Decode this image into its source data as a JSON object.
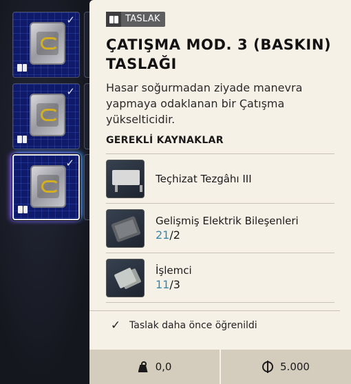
{
  "inventory": {
    "slots": [
      {
        "icon": "blueprint-crate-icon",
        "learned": true,
        "selected": false
      },
      {
        "icon": "blueprint-crate-icon",
        "learned": true,
        "selected": false
      },
      {
        "icon": "blueprint-crate-icon",
        "learned": true,
        "selected": true
      }
    ]
  },
  "tooltip": {
    "tag": "TASLAK",
    "title": "ÇATIŞMA MOD. 3 (BASKIN) TASLAĞI",
    "description": "Hasar soğurmadan ziyade manevra yapmaya odaklanan bir Çatışma yükselticidir.",
    "requirements_title": "GEREKLİ KAYNAKLAR",
    "requirements": [
      {
        "icon": "workbench-icon",
        "name": "Teçhizat Tezgâhı III",
        "have": "",
        "need": ""
      },
      {
        "icon": "circuit-board-icon",
        "name": "Gelişmiş Elektrik Bileşenleri",
        "have": "21",
        "need": "/2"
      },
      {
        "icon": "processor-chip-icon",
        "name": "İşlemci",
        "have": "11",
        "need": "/3"
      }
    ],
    "learned_text": "Taslak daha önce öğrenildi",
    "weight": "0,0",
    "price": "5.000"
  },
  "colors": {
    "panel_bg": "#f6f1e6",
    "footer_bg": "#d4cdbd",
    "have_quantity": "#3a86a8",
    "tag_bg": "#5f5f62"
  }
}
